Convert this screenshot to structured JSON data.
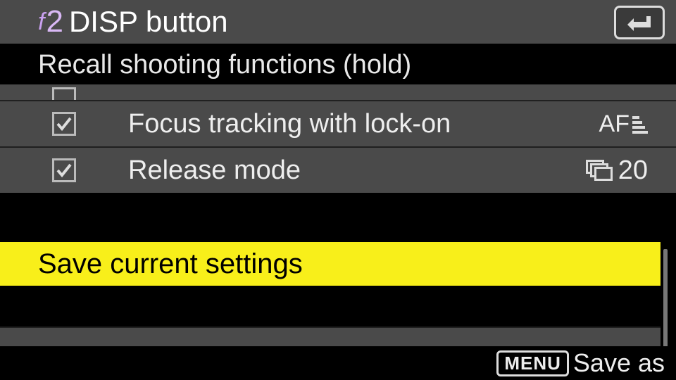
{
  "header": {
    "prefix_letter": "f",
    "prefix_number": "2",
    "title": "DISP button"
  },
  "subheader": "Recall shooting functions (hold)",
  "rows": [
    {
      "checked": true,
      "label": "Focus tracking with lock-on",
      "value_prefix": "AF"
    },
    {
      "checked": true,
      "label": "Release mode",
      "value_number": "20"
    }
  ],
  "highlight": "Save current settings",
  "footer": {
    "badge": "MENU",
    "label": "Save as"
  }
}
